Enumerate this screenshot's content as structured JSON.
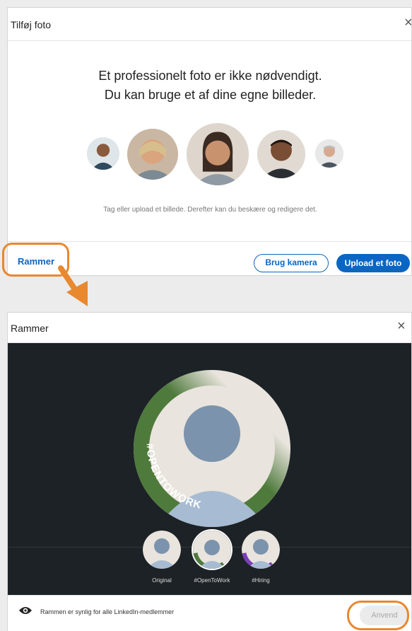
{
  "add_photo": {
    "title": "Tilføj foto",
    "close_icon": "×",
    "headline_line1": "Et professionelt foto er ikke nødvendigt.",
    "headline_line2": "Du kan bruge et af dine egne billeder.",
    "hint": "Tag eller upload et billede. Derefter kan du beskære og redigere det.",
    "frames_link": "Rammer",
    "camera_button": "Brug kamera",
    "upload_button": "Upload et foto"
  },
  "frames": {
    "title": "Rammer",
    "close_icon": "×",
    "ring_text": "#OPENTOWORK",
    "options": [
      {
        "label": "Original"
      },
      {
        "label": "#OpenToWork"
      },
      {
        "label": "#Hiring"
      }
    ],
    "visibility_text": "Rammen er synlig for alle LinkedIn-medlemmer",
    "apply_button": "Anvend"
  },
  "colors": {
    "accent": "#0a66c2",
    "highlight": "#e8882f",
    "open_to_work_green": "#4e7a3c",
    "hiring_purple": "#7b3fb8",
    "dark_bg": "#1d2226"
  }
}
